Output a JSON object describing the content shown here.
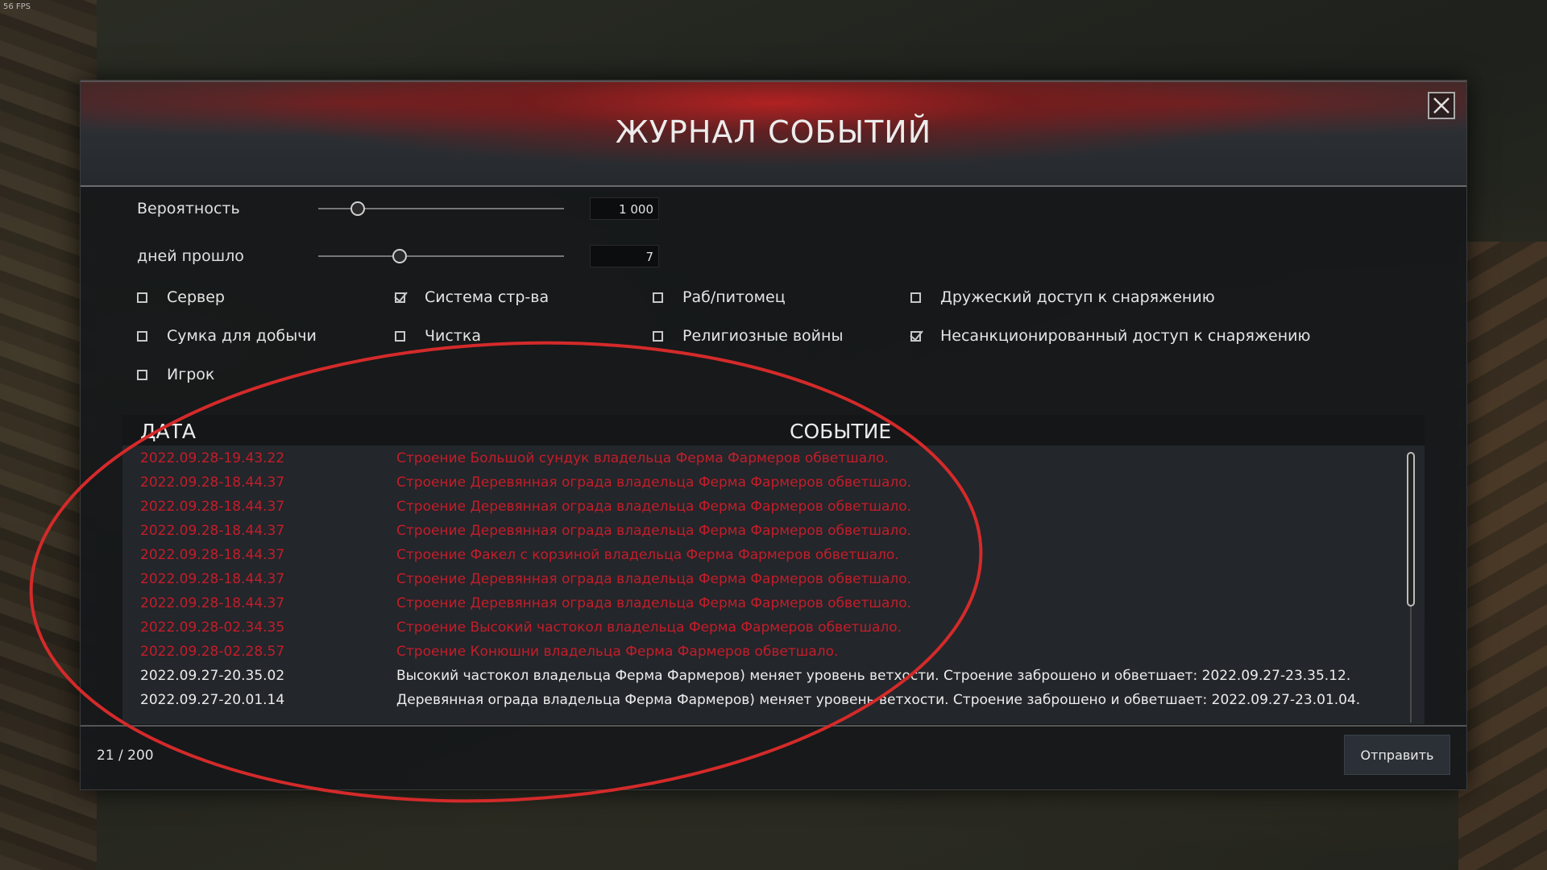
{
  "hud": {
    "fps": "56 FPS"
  },
  "dialog": {
    "title": "ЖУРНАЛ СОБЫТИЙ",
    "close_icon": "close-icon"
  },
  "filters": {
    "probability": {
      "label": "Вероятность",
      "value": "1 000",
      "level": 0.16
    },
    "days_passed": {
      "label": "дней прошло",
      "value": "7",
      "level": 0.33
    }
  },
  "checkboxes": [
    {
      "label": "Сервер",
      "checked": false
    },
    {
      "label": "Система стр-ва",
      "checked": true
    },
    {
      "label": "Раб/питомец",
      "checked": false
    },
    {
      "label": "Дружеский доступ к снаряжению",
      "checked": false
    },
    {
      "label": "Сумка для добычи",
      "checked": false
    },
    {
      "label": "Чистка",
      "checked": false
    },
    {
      "label": "Религиозные войны",
      "checked": false
    },
    {
      "label": "Несанкционированный доступ к снаряжению",
      "checked": true
    },
    {
      "label": "Игрок",
      "checked": false
    }
  ],
  "table": {
    "headers": {
      "date": "ДАТА",
      "event": "СОБЫТИЕ"
    },
    "rows": [
      {
        "date": "2022.09.28-19.43.22",
        "event": "Строение Большой сундук владельца Ферма Фармеров обветшало.",
        "color": "#c41d2a"
      },
      {
        "date": "2022.09.28-18.44.37",
        "event": "Строение Деревянная ограда владельца Ферма Фармеров обветшало.",
        "color": "#c41d2a"
      },
      {
        "date": "2022.09.28-18.44.37",
        "event": "Строение Деревянная ограда владельца Ферма Фармеров обветшало.",
        "color": "#c41d2a"
      },
      {
        "date": "2022.09.28-18.44.37",
        "event": "Строение Деревянная ограда владельца Ферма Фармеров обветшало.",
        "color": "#c41d2a"
      },
      {
        "date": "2022.09.28-18.44.37",
        "event": "Строение Факел с корзиной  владельца Ферма Фармеров обветшало.",
        "color": "#c41d2a"
      },
      {
        "date": "2022.09.28-18.44.37",
        "event": "Строение Деревянная ограда владельца Ферма Фармеров обветшало.",
        "color": "#c41d2a"
      },
      {
        "date": "2022.09.28-18.44.37",
        "event": "Строение Деревянная ограда владельца Ферма Фармеров обветшало.",
        "color": "#c41d2a"
      },
      {
        "date": "2022.09.28-02.34.35",
        "event": "Строение Высокий частокол владельца Ферма Фармеров обветшало.",
        "color": "#c41d2a"
      },
      {
        "date": "2022.09.28-02.28.57",
        "event": "Строение Конюшни владельца Ферма Фармеров обветшало.",
        "color": "#c41d2a"
      },
      {
        "date": "2022.09.27-20.35.02",
        "event": "Высокий частокол владельца Ферма Фармеров) меняет уровень ветхости. Строение заброшено и обветшает: 2022.09.27-23.35.12.",
        "color": "#ececec"
      },
      {
        "date": "2022.09.27-20.01.14",
        "event": "Деревянная ограда владельца Ферма Фармеров) меняет уровень ветхости. Строение заброшено и обветшает: 2022.09.27-23.01.04.",
        "color": "#ececec"
      }
    ]
  },
  "footer": {
    "counter": "21 / 200",
    "send_label": "Отправить"
  },
  "annotation_color": "#d42a2a"
}
